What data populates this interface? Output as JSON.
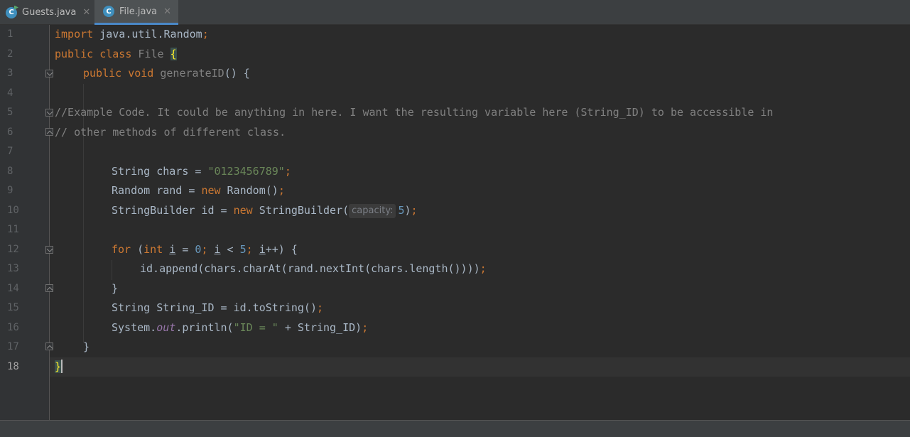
{
  "tabs": [
    {
      "label": "Guests.java",
      "icon": "java-class-runnable-icon",
      "active": false
    },
    {
      "label": "File.java",
      "icon": "java-class-icon",
      "active": true
    }
  ],
  "icon_letter": "C",
  "close_glyph": "✕",
  "line_numbers": [
    "1",
    "2",
    "3",
    "4",
    "5",
    "6",
    "7",
    "8",
    "9",
    "10",
    "11",
    "12",
    "13",
    "14",
    "15",
    "16",
    "17",
    "18"
  ],
  "code": {
    "l1": {
      "kw": "import",
      "rest": " java.util.Random",
      "semi": ";"
    },
    "l2": {
      "kw1": "public",
      "kw2": "class",
      "name": "File",
      "brace": "{"
    },
    "l3": {
      "kw1": "public",
      "kw2": "void",
      "method": "generateID",
      "rest": "() {"
    },
    "l5": "//Example Code. It could be anything in here. I want the resulting variable here (String_ID) to be accessible in",
    "l6": "// other methods of different class.",
    "l8": {
      "pre": "String chars = ",
      "str": "\"0123456789\"",
      "semi": ";"
    },
    "l9": {
      "pre": "Random rand = ",
      "kw": "new",
      "post": " Random()",
      "semi": ";"
    },
    "l10": {
      "pre": "StringBuilder id = ",
      "kw": "new",
      "post": " StringBuilder(",
      "hint": "capacity:",
      "num": "5",
      "close": ")",
      "semi": ";"
    },
    "l12": {
      "kw_for": "for",
      "p1": " (",
      "kw_int": "int",
      "sp": " ",
      "var": "i",
      "eq": " = ",
      "zero": "0",
      "semi1": ";",
      "sp2": " ",
      "var2": "i",
      "lt": " < ",
      "five": "5",
      "semi2": ";",
      "sp3": " ",
      "var3": "i",
      "inc": "++) {"
    },
    "l13": {
      "code": "id.append(chars.charAt(rand.nextInt(chars.length())))",
      "semi": ";"
    },
    "l14": "}",
    "l15": {
      "code": "String String_ID = id.toString()",
      "semi": ";"
    },
    "l16": {
      "pre": "System.",
      "field": "out",
      "mid": ".println(",
      "str": "\"ID = \"",
      "post": " + String_ID)",
      "semi": ";"
    },
    "l17": "}",
    "l18": "}"
  },
  "colors": {
    "background": "#2b2b2b",
    "keyword": "#cc7832",
    "string": "#6a8759",
    "number": "#6897bb",
    "comment": "#808080",
    "accent_tab": "#4a88c7"
  }
}
